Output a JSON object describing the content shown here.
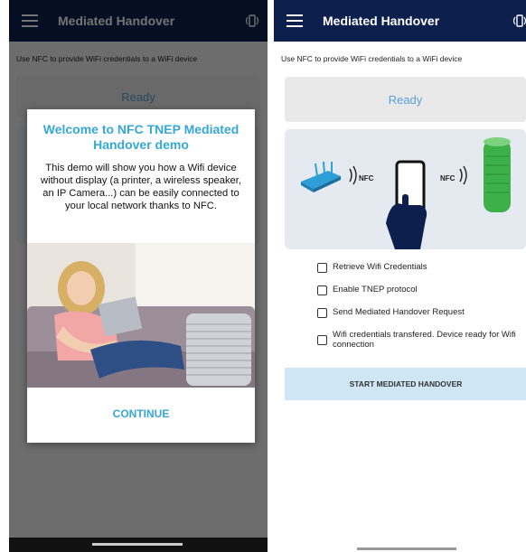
{
  "app": {
    "title": "Mediated Handover",
    "subtitle": "Use NFC to provide WiFi credentials to a WiFi device",
    "status": "Ready"
  },
  "dialog": {
    "title": "Welcome to NFC TNEP Mediated Handover demo",
    "body": "This demo will show you how a Wifi device without display (a printer, a wireless speaker, an IP Camera...) can be easily connected to your local network thanks to NFC.",
    "continue_label": "CONTINUE"
  },
  "illustration": {
    "nfc_left": "NFC",
    "nfc_right": "NFC"
  },
  "checklist": [
    {
      "label": "Retrieve Wifi Credentials",
      "checked": false
    },
    {
      "label": "Enable TNEP protocol",
      "checked": false
    },
    {
      "label": "Send Mediated Handover Request",
      "checked": false
    },
    {
      "label": "Wifi credentials transfered. Device ready for Wifi connection",
      "checked": false
    }
  ],
  "start_button": "START MEDIATED HANDOVER",
  "colors": {
    "appbar": "#0d1f4d",
    "accent": "#35a8d8",
    "button": "#cfe6f5",
    "device_green": "#3db04a",
    "router_blue": "#2f9fd8"
  }
}
